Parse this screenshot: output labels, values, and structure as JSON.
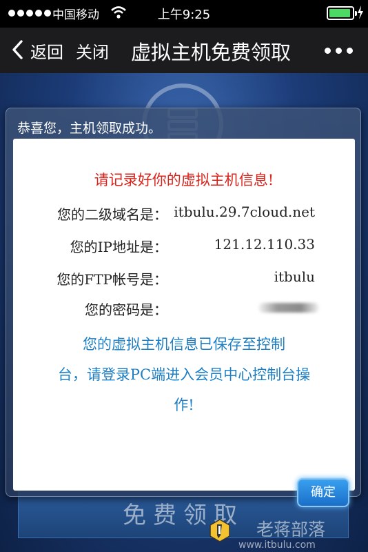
{
  "status_bar": {
    "carrier": "中国移动",
    "time": "上午9:25"
  },
  "nav": {
    "back_label": "返回",
    "close_label": "关闭",
    "title": "虚拟主机免费领取"
  },
  "background": {
    "claim_button_label": "免费领取",
    "watermark_name": "老蒋部落",
    "watermark_url": "www.itbulu.com"
  },
  "dialog": {
    "header": "恭喜您，主机领取成功。",
    "notice": "请记录好你的虚拟主机信息!",
    "rows": [
      {
        "label": "您的二级域名是：",
        "value": "itbulu.29.7cloud.net"
      },
      {
        "label": "您的IP地址是：",
        "value": "121.12.110.33"
      },
      {
        "label": "您的FTP帐号是：",
        "value": "itbulu"
      },
      {
        "label": "您的密码是：",
        "value": ""
      }
    ],
    "info_lines": [
      "您的虚拟主机信息已保存至控制",
      "台，请登录PC端进入会员中心控制台操",
      "作!"
    ],
    "confirm_label": "确定"
  },
  "colors": {
    "notice_red": "#d9241c",
    "info_blue": "#1e7fc4",
    "button_blue": "#1a6fc8",
    "battery_green": "#4cd964"
  }
}
